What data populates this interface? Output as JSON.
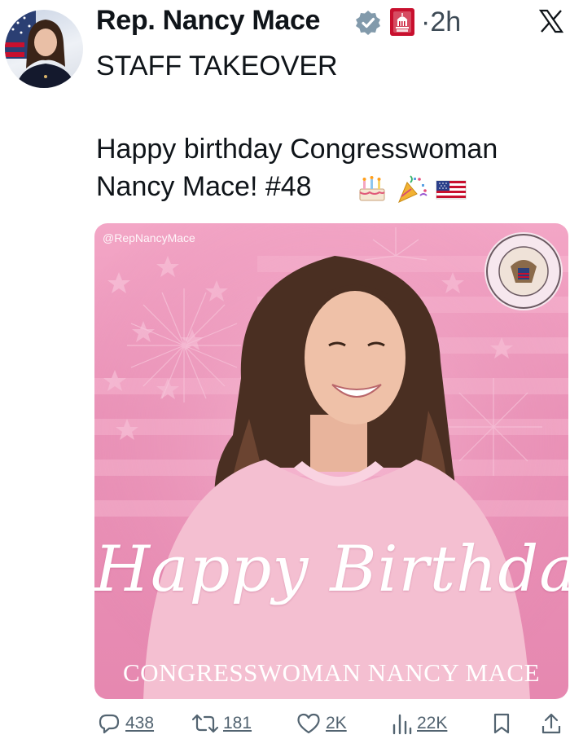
{
  "post": {
    "author": "Rep. Nancy Mace",
    "time": "·2h",
    "line1": "STAFF TAKEOVER",
    "line2": "Happy birthday Congresswoman",
    "line3": "Nancy Mace! #48",
    "emojis": [
      "birthday-cake",
      "party-popper",
      "us-flag"
    ]
  },
  "card": {
    "watermark": "@RepNancyMace",
    "seal_text": "U.S. HOUSE OF REPRESENTATIVES",
    "script": "Happy Birthday",
    "caption": "CONGRESSWOMAN NANCY MACE"
  },
  "actions": {
    "replies": "438",
    "reposts": "181",
    "likes": "2K",
    "views": "22K"
  },
  "colors": {
    "verified": "#829aab",
    "card_pink": "#ea93b8",
    "muted": "#536471"
  },
  "icons": [
    "verified-badge-icon",
    "house-gop-badge-icon",
    "x-logo-icon",
    "reply-icon",
    "repost-icon",
    "like-icon",
    "views-icon",
    "bookmark-icon",
    "share-icon"
  ]
}
